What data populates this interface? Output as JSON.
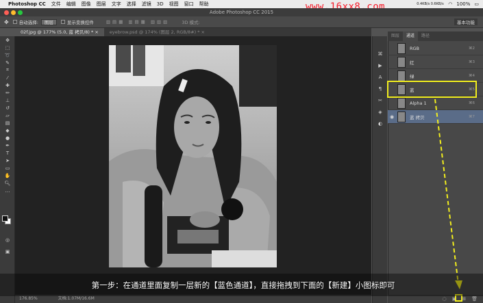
{
  "menubar": {
    "app": "Photoshop CC",
    "items": [
      "文件",
      "编辑",
      "图像",
      "图层",
      "文字",
      "选择",
      "滤镜",
      "3D",
      "视图",
      "窗口",
      "帮助"
    ],
    "net": "0.4KB/s 0.6KB/s",
    "battery": "100%"
  },
  "watermark": "www.16xx8.com",
  "window_title": "Adobe Photoshop CC 2015",
  "options": {
    "auto_select": "自动选择:",
    "layer_select": "图层",
    "show_transform": "显示变换控件",
    "mode_3d": "3D 模式:",
    "workspace": "基本功能"
  },
  "tabs": [
    {
      "label": "02f.jpg @ 177% (5.0, 蓝 拷贝/8) *"
    },
    {
      "label": "eyebrow.psd @ 174% (图层 2, RGB/8#) *"
    }
  ],
  "panel_tabs": [
    "图层",
    "通道",
    "路径"
  ],
  "channels": [
    {
      "name": "RGB",
      "shortcut": "⌘2",
      "visible": false,
      "selected": false
    },
    {
      "name": "红",
      "shortcut": "⌘3",
      "visible": false,
      "selected": false
    },
    {
      "name": "绿",
      "shortcut": "⌘4",
      "visible": false,
      "selected": false
    },
    {
      "name": "蓝",
      "shortcut": "⌘5",
      "visible": false,
      "selected": false
    },
    {
      "name": "Alpha 1",
      "shortcut": "⌘6",
      "visible": false,
      "selected": false
    },
    {
      "name": "蓝 拷贝",
      "shortcut": "⌘7",
      "visible": true,
      "selected": true
    }
  ],
  "status": {
    "zoom": "176.85%",
    "doc": "文档:1.07M/16.6M"
  },
  "caption": "第一步：在通道里面复制一层新的【蓝色通道】，直接拖拽到下面的【新建】小图标即可",
  "colors": {
    "highlight": "#f2ee1e",
    "selected_row": "#5a6c88"
  }
}
